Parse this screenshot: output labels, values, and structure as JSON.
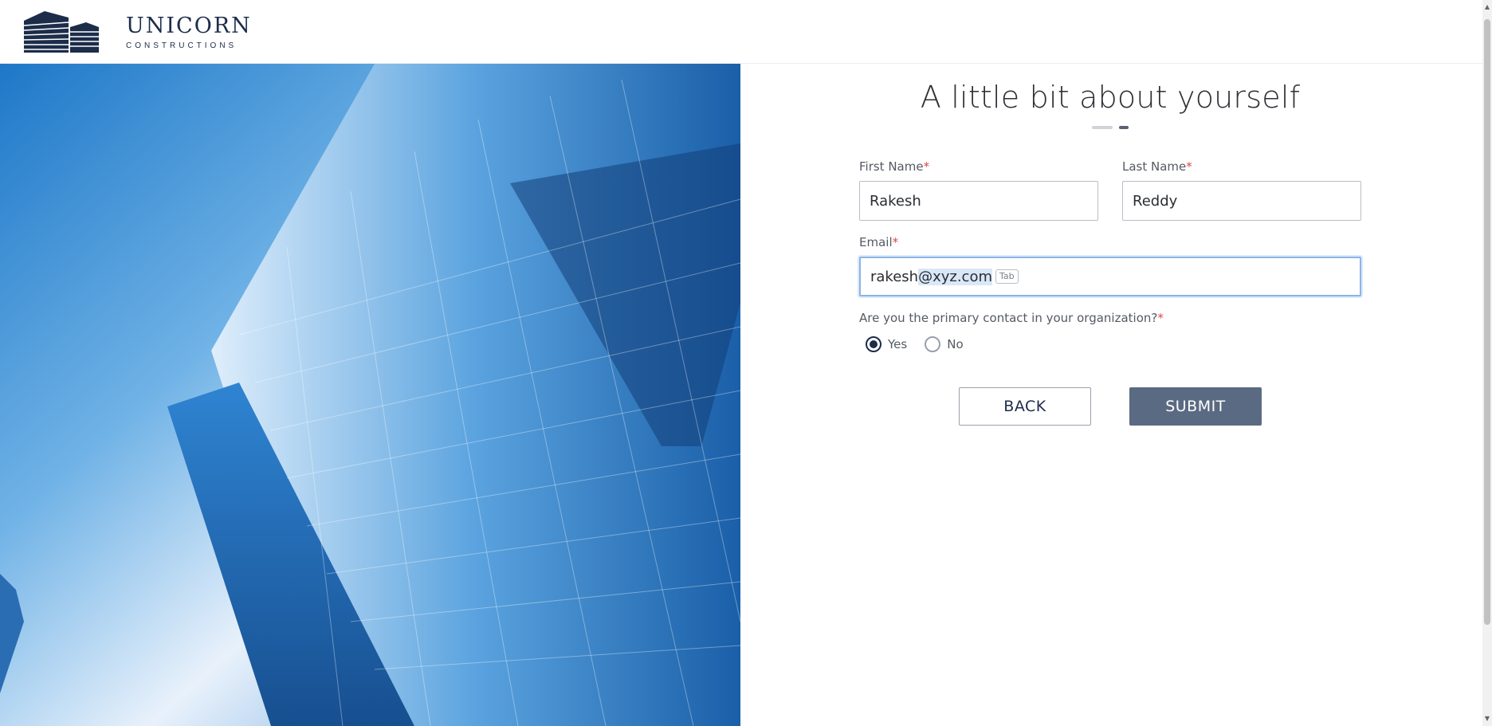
{
  "brand": {
    "name": "UNICORN",
    "tagline": "CONSTRUCTIONS"
  },
  "form": {
    "title": "A little bit about yourself",
    "steps": {
      "total": 2,
      "current": 2
    },
    "first_name": {
      "label": "First Name",
      "value": "Rakesh"
    },
    "last_name": {
      "label": "Last Name",
      "value": "Reddy"
    },
    "email": {
      "label": "Email",
      "value_prefix": "rakesh",
      "value_selected": "@xyz.com",
      "hint": "Tab"
    },
    "required_mark": "*",
    "primary_contact": {
      "question": "Are you the primary contact in your organization?",
      "options": [
        {
          "label": "Yes",
          "checked": true
        },
        {
          "label": "No",
          "checked": false
        }
      ]
    },
    "back_label": "BACK",
    "submit_label": "SUBMIT"
  },
  "colors": {
    "brand_navy": "#1c2d4a",
    "submit_bg": "#5a6a82",
    "required": "#d94848",
    "focus_border": "#8ab4e8"
  }
}
